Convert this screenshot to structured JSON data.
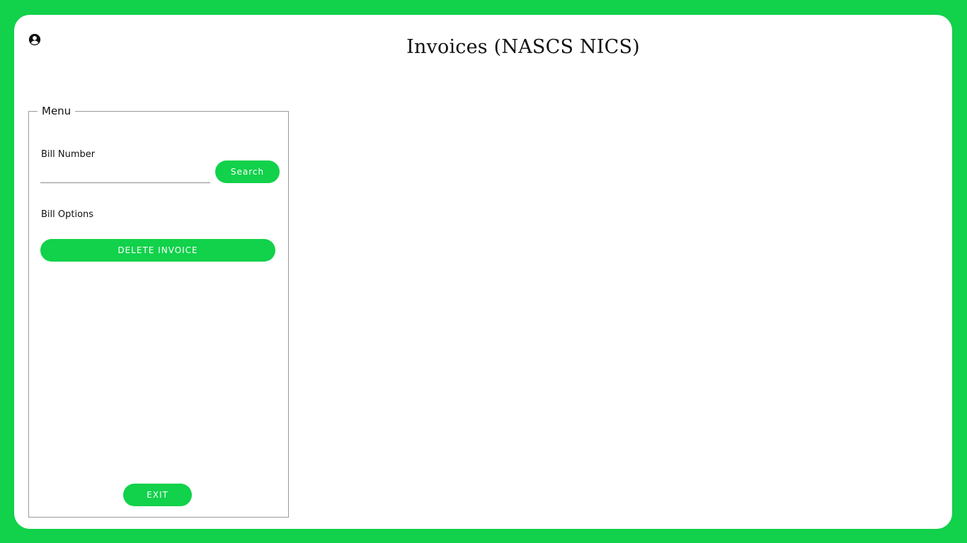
{
  "header": {
    "title": "Invoices (NASCS NICS)",
    "user_icon": "user-circle-icon"
  },
  "menu": {
    "legend": "Menu",
    "bill_number_label": "Bill Number",
    "bill_number_value": "",
    "search_label": "Search",
    "bill_options_label": "Bill Options",
    "delete_invoice_label": "DELETE INVOICE",
    "exit_label": "EXIT"
  },
  "colors": {
    "accent": "#12d14b",
    "background": "#ffffff",
    "highlight": "#e21b1b"
  }
}
